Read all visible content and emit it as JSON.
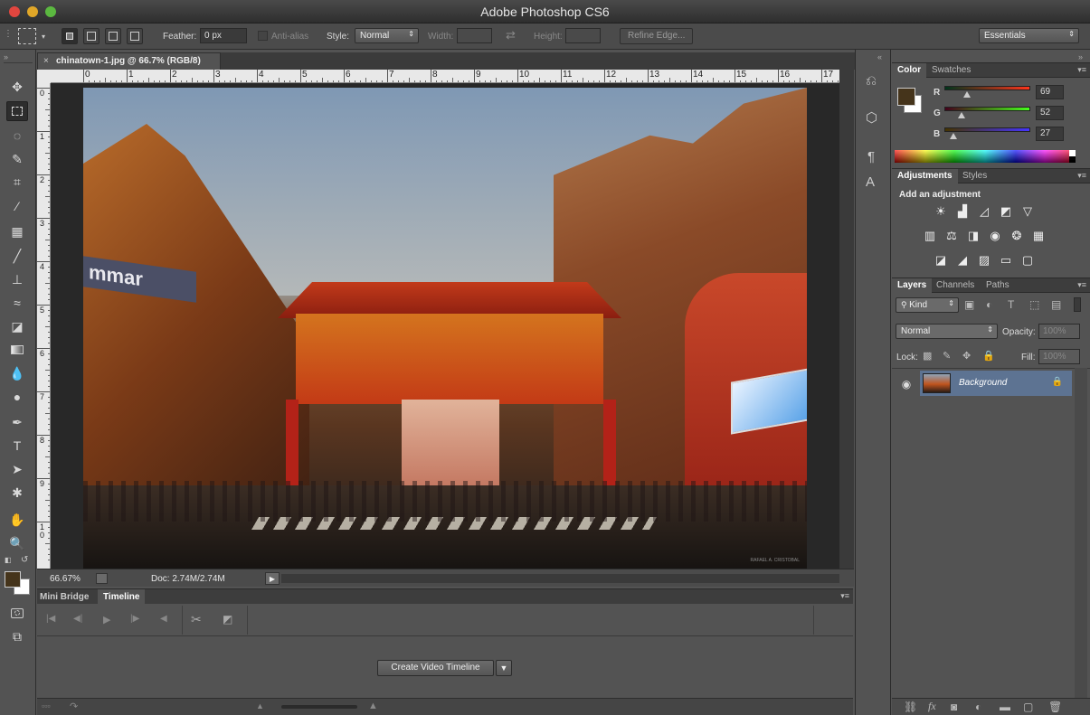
{
  "app": {
    "window_title": "Adobe Photoshop CS6"
  },
  "options_bar": {
    "feather_label": "Feather:",
    "feather_value": "0 px",
    "anti_alias_label": "Anti-alias",
    "style_label": "Style:",
    "style_value": "Normal",
    "width_label": "Width:",
    "height_label": "Height:",
    "refine_edge_label": "Refine Edge...",
    "workspace_value": "Essentials"
  },
  "document": {
    "tab_title": "chinatown-1.jpg @ 66.7% (RGB/8)",
    "close_glyph": "×",
    "h_ruler_ticks": [
      "0",
      "1",
      "2",
      "3",
      "4",
      "5",
      "6",
      "7",
      "8",
      "9",
      "10",
      "11",
      "12",
      "13",
      "14",
      "15",
      "16",
      "17"
    ],
    "v_ruler_ticks": [
      "0",
      "1",
      "2",
      "3",
      "4",
      "5",
      "6",
      "7",
      "8",
      "9",
      "1\n0"
    ],
    "watermark": "RAFAEL A. CRISTOBAL"
  },
  "status_bar": {
    "zoom": "66.67%",
    "doc_size": "Doc: 2.74M/2.74M"
  },
  "bottom_panel": {
    "tabs": [
      {
        "label": "Mini Bridge",
        "active": false
      },
      {
        "label": "Timeline",
        "active": true
      }
    ],
    "create_button": "Create Video Timeline"
  },
  "color_panel": {
    "tabs": [
      {
        "label": "Color",
        "active": true
      },
      {
        "label": "Swatches",
        "active": false
      }
    ],
    "foreground_color": "#45341b",
    "background_color": "#ffffff",
    "channels": [
      {
        "label": "R",
        "value": "69",
        "fraction": 0.27
      },
      {
        "label": "G",
        "value": "52",
        "fraction": 0.2
      },
      {
        "label": "B",
        "value": "27",
        "fraction": 0.11
      }
    ]
  },
  "adjustments_panel": {
    "tabs": [
      {
        "label": "Adjustments",
        "active": true
      },
      {
        "label": "Styles",
        "active": false
      }
    ],
    "heading": "Add an adjustment",
    "icons": [
      "brightness-contrast-icon",
      "levels-icon",
      "curves-icon",
      "exposure-icon",
      "vibrance-icon",
      "hue-saturation-icon",
      "color-balance-icon",
      "black-white-icon",
      "photo-filter-icon",
      "channel-mixer-icon",
      "color-lookup-icon",
      "invert-icon",
      "posterize-icon",
      "threshold-icon",
      "gradient-map-icon"
    ]
  },
  "layers_panel": {
    "tabs": [
      {
        "label": "Layers",
        "active": true
      },
      {
        "label": "Channels",
        "active": false
      },
      {
        "label": "Paths",
        "active": false
      }
    ],
    "filter_kind": "Kind",
    "blend_mode": "Normal",
    "opacity_label": "Opacity:",
    "opacity_value": "100%",
    "lock_label": "Lock:",
    "fill_label": "Fill:",
    "fill_value": "100%",
    "layers": [
      {
        "name": "Background",
        "visible": true,
        "locked": true,
        "selected": true
      }
    ]
  }
}
